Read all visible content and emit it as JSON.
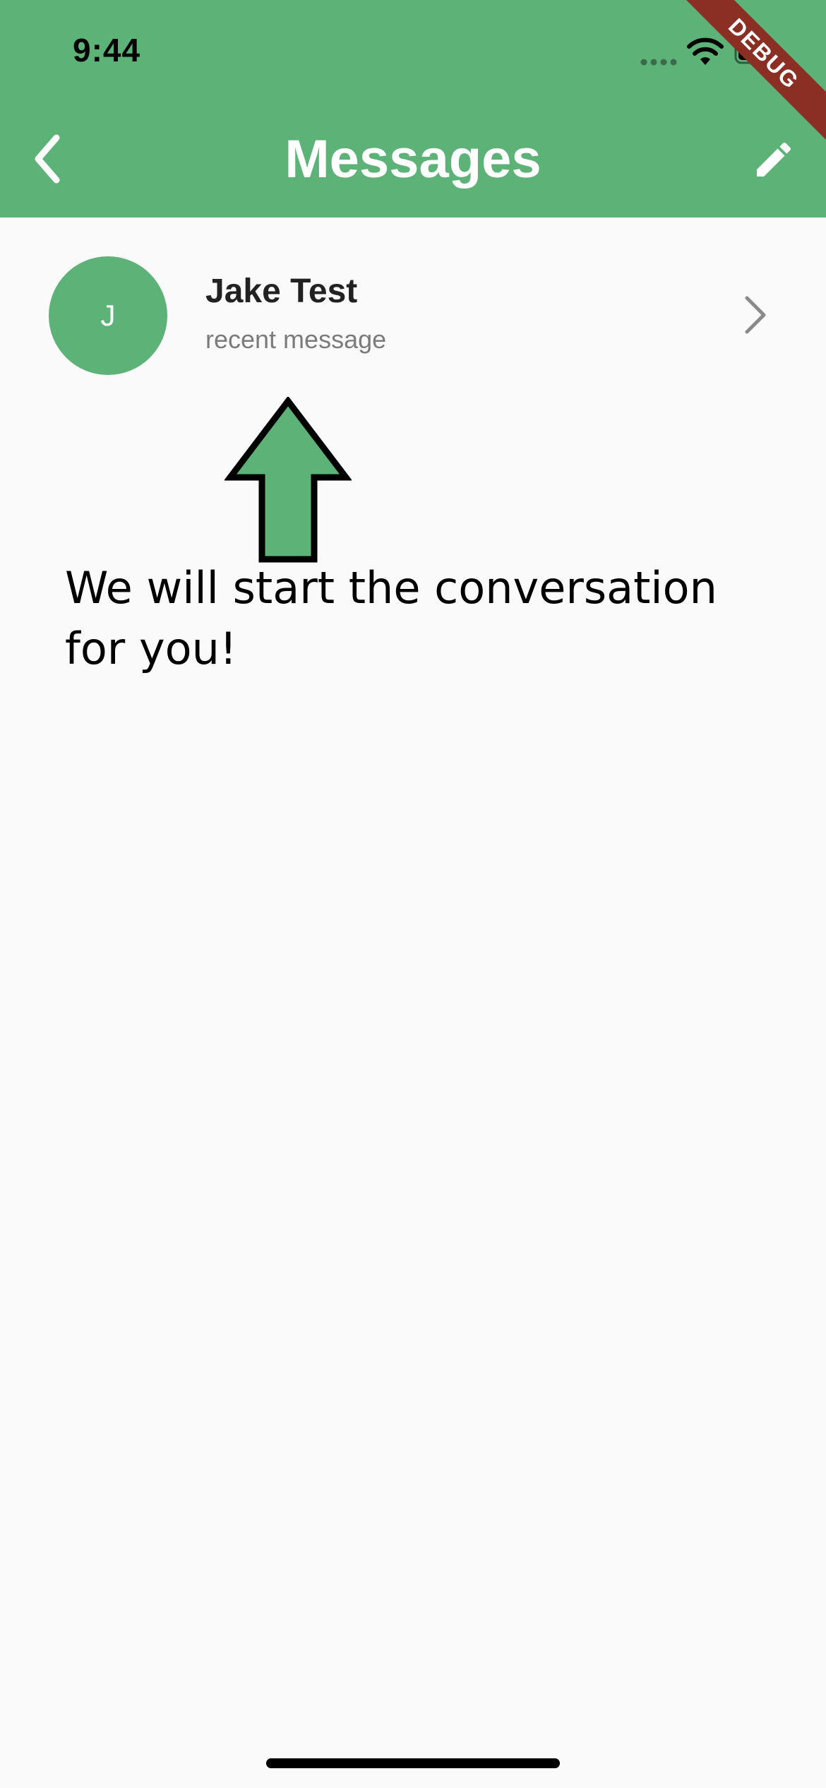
{
  "status_bar": {
    "time": "9:44"
  },
  "app_bar": {
    "title": "Messages",
    "color": "#5db377",
    "back_icon": "chevron-left-icon",
    "edit_icon": "pencil-icon"
  },
  "debug_banner": {
    "label": "DEBUG",
    "color": "#8b2e24"
  },
  "conversations": [
    {
      "avatar_initial": "J",
      "name": "Jake Test",
      "preview": "recent message"
    }
  ],
  "annotation": {
    "caption": "We will start the conversation for you!",
    "arrow_color": "#5db377"
  }
}
